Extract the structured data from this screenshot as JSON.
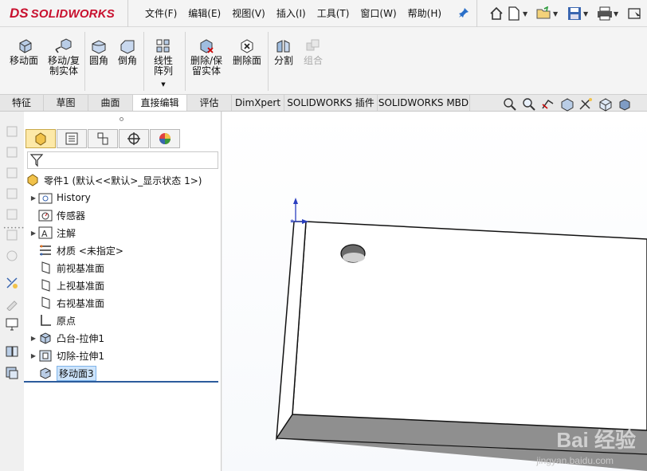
{
  "app": {
    "logo_ds": "DS",
    "logo_text": "SOLIDWORKS"
  },
  "menu": {
    "items": [
      "文件(F)",
      "编辑(E)",
      "视图(V)",
      "插入(I)",
      "工具(T)",
      "窗口(W)",
      "帮助(H)"
    ]
  },
  "quick_access": {
    "icons": [
      "home-icon",
      "new-document-icon",
      "open-icon",
      "save-icon",
      "print-icon",
      "select-icon"
    ]
  },
  "commands": {
    "move_face": "移动面",
    "move_copy_body": "移动/复制实体",
    "fillet": "圆角",
    "chamfer": "倒角",
    "linear_pattern": "线性阵列",
    "delete_keep_body": "删除/保留实体",
    "delete_face": "删除面",
    "split": "分割",
    "combine": "组合"
  },
  "tabs": [
    {
      "label": "特征",
      "active": false
    },
    {
      "label": "草图",
      "active": false
    },
    {
      "label": "曲面",
      "active": false
    },
    {
      "label": "直接编辑",
      "active": true
    },
    {
      "label": "评估",
      "active": false
    },
    {
      "label": "DimXpert",
      "active": false
    },
    {
      "label": "SOLIDWORKS 插件",
      "active": false
    },
    {
      "label": "SOLIDWORKS MBD",
      "active": false
    }
  ],
  "feature_tree": {
    "root": "零件1  (默认<<默认>_显示状态 1>)",
    "nodes": [
      {
        "label": "History",
        "icon": "history-folder-icon",
        "expandable": true,
        "selected": false
      },
      {
        "label": "传感器",
        "icon": "sensor-icon",
        "expandable": false,
        "selected": false
      },
      {
        "label": "注解",
        "icon": "annotation-icon",
        "expandable": true,
        "selected": false
      },
      {
        "label": "材质 <未指定>",
        "icon": "material-icon",
        "expandable": false,
        "selected": false
      },
      {
        "label": "前视基准面",
        "icon": "plane-icon",
        "expandable": false,
        "selected": false
      },
      {
        "label": "上视基准面",
        "icon": "plane-icon",
        "expandable": false,
        "selected": false
      },
      {
        "label": "右视基准面",
        "icon": "plane-icon",
        "expandable": false,
        "selected": false
      },
      {
        "label": "原点",
        "icon": "origin-icon",
        "expandable": false,
        "selected": false
      },
      {
        "label": "凸台-拉伸1",
        "icon": "boss-extrude-icon",
        "expandable": true,
        "selected": false
      },
      {
        "label": "切除-拉伸1",
        "icon": "cut-extrude-icon",
        "expandable": true,
        "selected": false
      },
      {
        "label": "移动面3",
        "icon": "move-face-icon",
        "expandable": false,
        "selected": true
      }
    ]
  },
  "watermark": {
    "main": "Bai 经验",
    "sub": "jingyan.baidu.com"
  },
  "colors": {
    "brand_red": "#c8102e",
    "selection_blue": "#cde4fb",
    "active_tab_yellow": "#fde9a8"
  }
}
